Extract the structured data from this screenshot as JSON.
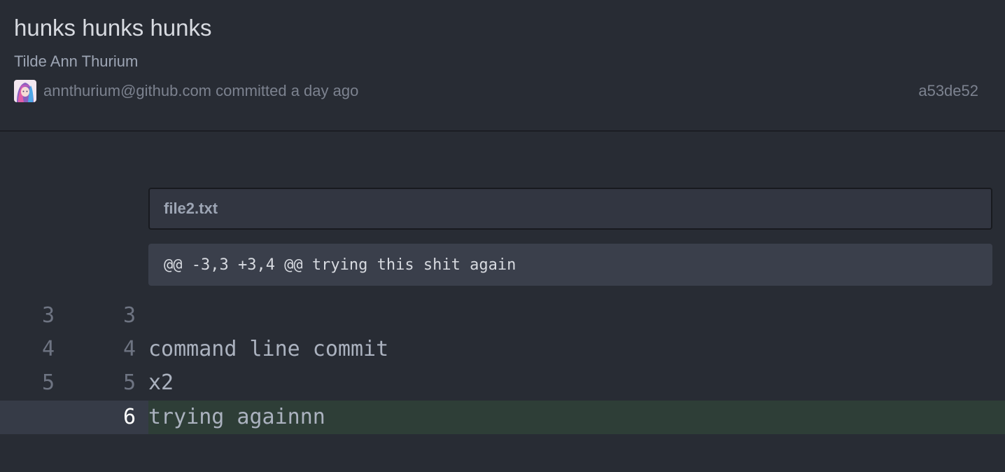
{
  "commit": {
    "title": "hunks hunks hunks",
    "author": "Tilde Ann Thurium",
    "meta": "annthurium@github.com committed a day ago",
    "sha": "a53de52",
    "avatar_icon": "user-avatar-image"
  },
  "diff": {
    "file_name": "file2.txt",
    "hunk_header": "@@ -3,3 +3,4 @@ trying this shit again",
    "lines": [
      {
        "old": "3",
        "new": "3",
        "text": "",
        "type": "context"
      },
      {
        "old": "4",
        "new": "4",
        "text": "command line commit",
        "type": "context"
      },
      {
        "old": "5",
        "new": "5",
        "text": "x2",
        "type": "context"
      },
      {
        "old": "",
        "new": "6",
        "text": "trying againnn",
        "type": "added"
      }
    ]
  },
  "colors": {
    "background": "#282c34",
    "added_line": "#2e3e37",
    "hunk_header": "#3a3f4b"
  }
}
